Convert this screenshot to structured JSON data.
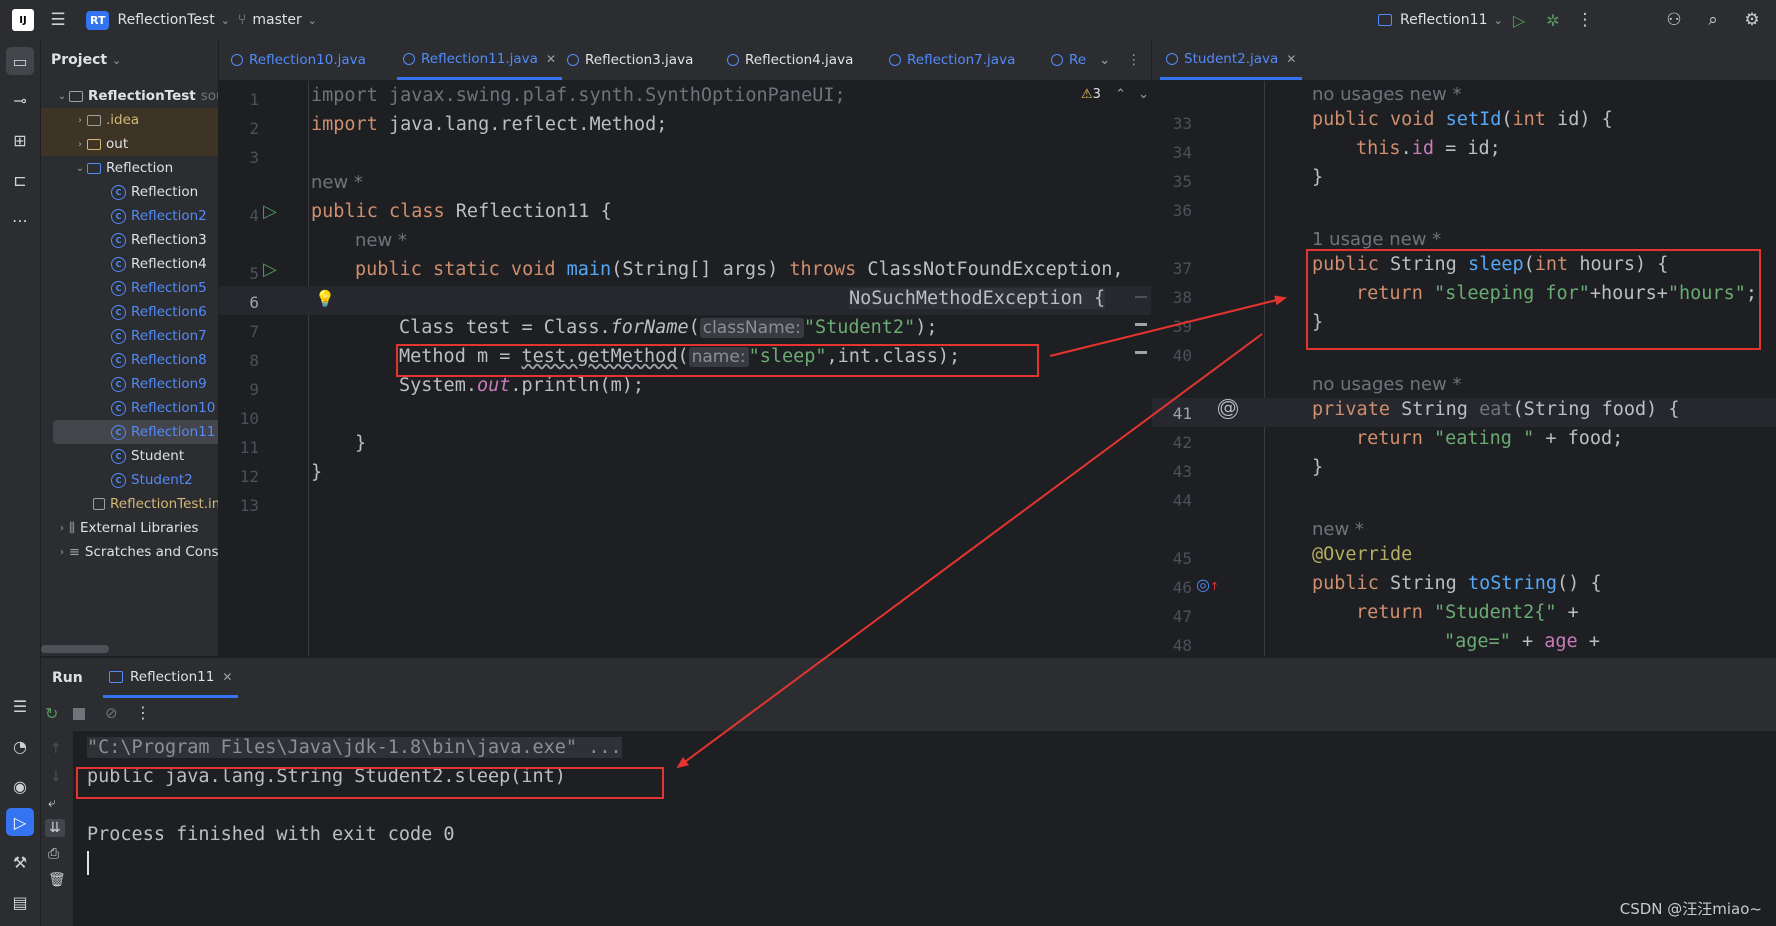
{
  "titlebar": {
    "app_logo": "IJ",
    "project_badge": "RT",
    "project_name": "ReflectionTest",
    "branch": "master",
    "run_config": "Reflection11"
  },
  "project_panel": {
    "title": "Project",
    "items": [
      {
        "label": "ReflectionTest",
        "suffix": "sour"
      },
      {
        "label": ".idea"
      },
      {
        "label": "out"
      },
      {
        "label": "Reflection"
      },
      {
        "label": "Reflection"
      },
      {
        "label": "Reflection2"
      },
      {
        "label": "Reflection3"
      },
      {
        "label": "Reflection4"
      },
      {
        "label": "Reflection5"
      },
      {
        "label": "Reflection6"
      },
      {
        "label": "Reflection7"
      },
      {
        "label": "Reflection8"
      },
      {
        "label": "Reflection9"
      },
      {
        "label": "Reflection10"
      },
      {
        "label": "Reflection11"
      },
      {
        "label": "Student"
      },
      {
        "label": "Student2"
      },
      {
        "label": "ReflectionTest.im"
      },
      {
        "label": "External Libraries"
      },
      {
        "label": "Scratches and Conso"
      }
    ]
  },
  "editor1": {
    "tabs": [
      "Reflection10.java",
      "Reflection11.java",
      "Reflection3.java",
      "Reflection4.java",
      "Reflection7.java",
      "Re"
    ],
    "warnings": "3",
    "gutter": [
      "1",
      "2",
      "3",
      "4",
      "5",
      "6",
      "7",
      "8",
      "9",
      "10",
      "11",
      "12",
      "13"
    ],
    "lines": {
      "l1": "import javax.swing.plaf.synth.SynthOptionPaneUI;",
      "l2_a": "import",
      "l2_b": " java.lang.reflect.Method;",
      "new1": "new *",
      "l4_a": "public class",
      "l4_b": " Reflection11 {",
      "new2": "new *",
      "l5_a": "public static void",
      "l5_b": "main",
      "l5_c": "(String[] args) ",
      "l5_d": "throws",
      "l5_e": " ClassNotFoundException,",
      "l6": "NoSuchMethodException {",
      "l7_a": "Class test = Class.",
      "l7_b": "forName",
      "l7_c": "(",
      "l7_hint": "className:",
      "l7_d": "\"Student2\"",
      "l7_e": ");",
      "l8_a": "Method m = ",
      "l8_b": "test.getMethod",
      "l8_c": "(",
      "l8_hint": "name:",
      "l8_d": "\"sleep\"",
      "l8_e": ",int.class);",
      "l9_a": "System.",
      "l9_b": "out",
      "l9_c": ".println(m);",
      "l11": "}",
      "l12": "}"
    }
  },
  "editor2": {
    "tab": "Student2.java",
    "gutter": [
      "33",
      "34",
      "35",
      "36",
      "37",
      "38",
      "39",
      "40",
      "41",
      "42",
      "43",
      "44",
      "45",
      "46",
      "47",
      "48"
    ],
    "lines": {
      "hint1": "no usages   new *",
      "s33_a": "public void",
      "s33_b": "setId",
      "s33_c": "(",
      "s33_d": "int",
      "s33_e": " id) {",
      "s34_a": "this",
      "s34_b": ".",
      "s34_c": "id",
      "s34_d": " = id;",
      "s35": "}",
      "hint2": "1 usage   new *",
      "s37_a": "public",
      "s37_b": " String ",
      "s37_c": "sleep",
      "s37_d": "(",
      "s37_e": "int",
      "s37_f": " hours) {",
      "s38_a": "return",
      "s38_b": "\"sleeping for\"",
      "s38_c": "+hours+",
      "s38_d": "\"hours\"",
      "s38_e": ";",
      "s39": "}",
      "hint3": "no usages   new *",
      "s41_a": "private",
      "s41_b": " String ",
      "s41_c": "eat",
      "s41_d": "(String food) {",
      "s42_a": "return",
      "s42_b": "\"eating \"",
      "s42_c": " + food;",
      "s43": "}",
      "hint4": "new *",
      "s45": "@Override",
      "s46_a": "public",
      "s46_b": " String ",
      "s46_c": "toString",
      "s46_d": "() {",
      "s47_a": "return",
      "s47_b": "\"Student2{\"",
      "s47_c": " +",
      "s48_a": "\"age=\"",
      "s48_b": " + ",
      "s48_c": "age",
      "s48_d": " +"
    }
  },
  "run": {
    "title": "Run",
    "tab": "Reflection11",
    "console": {
      "cmd": "\"C:\\Program Files\\Java\\jdk-1.8\\bin\\java.exe\" ...",
      "output": "public java.lang.String Student2.sleep(int)",
      "finish": "Process finished with exit code 0"
    }
  },
  "watermark": "CSDN @汪汪miao~",
  "colors": {
    "accent": "#3574f0",
    "annotation_red": "#e5342f",
    "keyword": "#cf8e6d",
    "string": "#6aab73",
    "function": "#56a8f5"
  }
}
